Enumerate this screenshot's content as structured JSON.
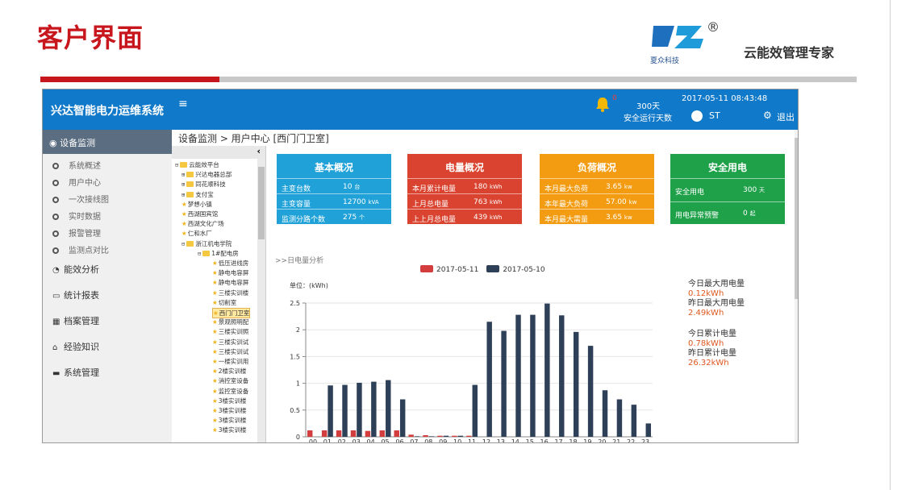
{
  "slide": {
    "title": "客户界面",
    "logo_text": "XZ",
    "logo_sub": "夏众科技",
    "registered": "®",
    "slogan": "云能效管理专家"
  },
  "app": {
    "title": "兴达智能电力运维系统",
    "menu_toggle": "≡",
    "alert_count": "0",
    "safe_days": "300天",
    "safe_days_label": "安全运行天数",
    "datetime": "2017-05-11 08:43:48",
    "user": "ST",
    "logout": "退出"
  },
  "sidebar": {
    "active": "设备监测",
    "sub_items": [
      "系统概述",
      "用户中心",
      "一次接线图",
      "实时数据",
      "报警管理",
      "监测点对比"
    ],
    "main_items": [
      {
        "icon": "pie-chart-icon",
        "label": "能效分析"
      },
      {
        "icon": "monitor-icon",
        "label": "统计报表"
      },
      {
        "icon": "table-icon",
        "label": "档案管理"
      },
      {
        "icon": "home-icon",
        "label": "经验知识"
      },
      {
        "icon": "folder-icon",
        "label": "系统管理"
      }
    ]
  },
  "breadcrumb": "设备监测 > 用户中心 [西门门卫室]",
  "tree": {
    "collapse": "‹",
    "nodes": [
      {
        "t": "folder",
        "pm": "⊟",
        "label": "云能效平台"
      },
      {
        "t": "folder",
        "pm": "⊞",
        "label": "兴达电器总部"
      },
      {
        "t": "folder",
        "pm": "⊞",
        "label": "同花顺科技"
      },
      {
        "t": "folder",
        "pm": "⊞",
        "label": "支付宝"
      },
      {
        "t": "star",
        "pm": "",
        "label": "梦想小镇"
      },
      {
        "t": "star",
        "pm": "",
        "label": "西湖国宾馆"
      },
      {
        "t": "star",
        "pm": "",
        "label": "西湖文化广场"
      },
      {
        "t": "star",
        "pm": "",
        "label": "仁和水厂"
      },
      {
        "t": "folder",
        "pm": "⊟",
        "label": "浙江机电学院"
      },
      {
        "t": "folder",
        "pm": "⊟",
        "label": "1#配电房"
      },
      {
        "t": "star",
        "pm": "",
        "label": "低压进线房"
      },
      {
        "t": "star",
        "pm": "",
        "label": "静电电容屏"
      },
      {
        "t": "star",
        "pm": "",
        "label": "静电电容屏"
      },
      {
        "t": "star",
        "pm": "",
        "label": "三楼实训楼"
      },
      {
        "t": "star",
        "pm": "",
        "label": "切削室"
      },
      {
        "t": "star",
        "pm": "",
        "label": "西门门卫室"
      },
      {
        "t": "star",
        "pm": "",
        "label": "景观照明配"
      },
      {
        "t": "star",
        "pm": "",
        "label": "三楼实训照"
      },
      {
        "t": "star",
        "pm": "",
        "label": "三楼实训试"
      },
      {
        "t": "star",
        "pm": "",
        "label": "三楼实训试"
      },
      {
        "t": "star",
        "pm": "",
        "label": "一楼实训用"
      },
      {
        "t": "star",
        "pm": "",
        "label": "2楼实训楼"
      },
      {
        "t": "star",
        "pm": "",
        "label": "消控室设备"
      },
      {
        "t": "star",
        "pm": "",
        "label": "监控室设备"
      },
      {
        "t": "star",
        "pm": "",
        "label": "3楼实训楼"
      },
      {
        "t": "star",
        "pm": "",
        "label": "3楼实训楼"
      },
      {
        "t": "star",
        "pm": "",
        "label": "3楼实训楼"
      },
      {
        "t": "star",
        "pm": "",
        "label": "3楼实训楼"
      }
    ]
  },
  "cards": [
    {
      "title": "基本概况",
      "color": "#20a2d8",
      "rows": [
        {
          "label": "主变台数",
          "value": "10",
          "unit": "台"
        },
        {
          "label": "主变容量",
          "value": "12700",
          "unit": "kVA"
        },
        {
          "label": "监测分路个数",
          "value": "275",
          "unit": "个"
        }
      ]
    },
    {
      "title": "电量概况",
      "color": "#d9432f",
      "rows": [
        {
          "label": "本月累计电量",
          "value": "180",
          "unit": "kWh"
        },
        {
          "label": "上月总电量",
          "value": "763",
          "unit": "kWh"
        },
        {
          "label": "上上月总电量",
          "value": "439",
          "unit": "kWh"
        }
      ]
    },
    {
      "title": "负荷概况",
      "color": "#f39c12",
      "rows": [
        {
          "label": "本月最大负荷",
          "value": "3.65",
          "unit": "kw"
        },
        {
          "label": "本年最大负荷",
          "value": "57.00",
          "unit": "kw"
        },
        {
          "label": "本月最大需量",
          "value": "3.65",
          "unit": "kw"
        }
      ]
    },
    {
      "title": "安全用电",
      "color": "#1fa14a",
      "rows": [
        {
          "label": "安全用电",
          "value": "300",
          "unit": "天"
        },
        {
          "label": "用电异常预警",
          "value": "0",
          "unit": "起"
        }
      ]
    }
  ],
  "analysis_label": ">>日电量分析",
  "stats": [
    {
      "label": "今日最大用电量",
      "value": "0.12kWh"
    },
    {
      "label": "昨日最大用电量",
      "value": "2.49kWh"
    },
    {
      "label": "今日累计电量",
      "value": "0.78kWh"
    },
    {
      "label": "昨日累计电量",
      "value": "26.32kWh"
    }
  ],
  "chart_data": {
    "type": "bar",
    "ylabel": "单位：(kWh)",
    "ylim": [
      0,
      2.5
    ],
    "yticks": [
      "0",
      "0.5",
      "1",
      "1.5",
      "2",
      "2.5"
    ],
    "categories": [
      "00",
      "01",
      "02",
      "03",
      "04",
      "05",
      "06",
      "07",
      "08",
      "09",
      "10",
      "11",
      "12",
      "13",
      "14",
      "15",
      "16",
      "17",
      "18",
      "19",
      "20",
      "21",
      "22",
      "23"
    ],
    "series": [
      {
        "name": "2017-05-11",
        "color": "#d43d3d",
        "values": [
          0.12,
          0.12,
          0.12,
          0.12,
          0.11,
          0.12,
          0.12,
          0.04,
          0.03,
          0.02,
          0.02,
          0.02,
          0,
          0,
          0,
          0,
          0,
          0,
          0,
          0,
          0,
          0,
          0,
          0
        ]
      },
      {
        "name": "2017-05-10",
        "color": "#2e4057",
        "values": [
          0,
          0.96,
          0.97,
          1.01,
          1.03,
          1.06,
          0.7,
          0.01,
          0.01,
          0.02,
          0.02,
          0.97,
          2.15,
          1.98,
          2.28,
          2.28,
          2.49,
          2.27,
          1.96,
          1.7,
          0.87,
          0.7,
          0.6,
          0.25
        ]
      }
    ],
    "legend": "top-center",
    "grid": true
  }
}
